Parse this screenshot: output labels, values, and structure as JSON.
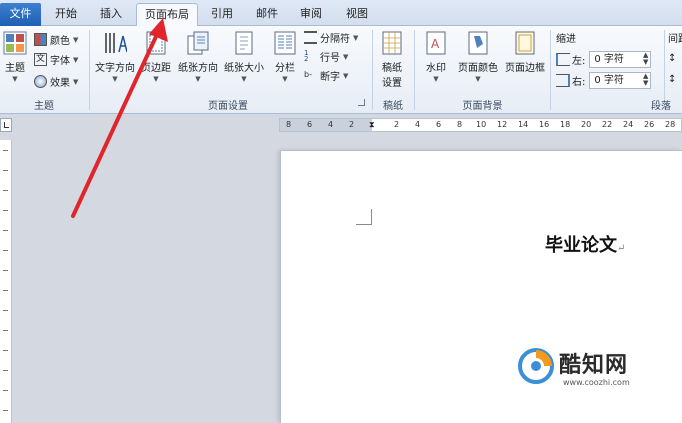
{
  "tabs": [
    {
      "label": "文件"
    },
    {
      "label": "开始"
    },
    {
      "label": "插入"
    },
    {
      "label": "页面布局"
    },
    {
      "label": "引用"
    },
    {
      "label": "邮件"
    },
    {
      "label": "审阅"
    },
    {
      "label": "视图"
    }
  ],
  "active_tab": "页面布局",
  "ribbon": {
    "theme_group": {
      "label": "主题",
      "theme_button": "主题",
      "colors": "颜色",
      "fonts": "字体",
      "effects": "效果"
    },
    "page_setup": {
      "label": "页面设置",
      "text_direction": "文字方向",
      "margins": "页边距",
      "orientation": "纸张方向",
      "size": "纸张大小",
      "columns": "分栏",
      "breaks": "分隔符",
      "line_numbers": "行号",
      "hyphenation": "断字"
    },
    "manuscript": {
      "label": "稿纸",
      "button_line1": "稿纸",
      "button_line2": "设置"
    },
    "page_background": {
      "label": "页面背景",
      "watermark": "水印",
      "page_color": "页面颜色",
      "page_borders": "页面边框"
    },
    "paragraph": {
      "label": "段落",
      "indent": "缩进",
      "spacing": "间距",
      "left_label": "左:",
      "left_value": "0 字符",
      "right_label": "右:",
      "right_value": "0 字符"
    }
  },
  "ruler": {
    "left_numbers": [
      "8",
      "6",
      "4",
      "2"
    ],
    "right_numbers": [
      "2",
      "4",
      "6",
      "8",
      "10",
      "12",
      "14",
      "16",
      "18",
      "20",
      "22",
      "24",
      "26",
      "28"
    ]
  },
  "document": {
    "title": "毕业论文",
    "paragraph_mark": "↵"
  },
  "watermark": {
    "name": "酷知网",
    "url": "www.coozhi.com"
  },
  "colors": {
    "accent": "#1d5fb3",
    "arrow": "#e0262c",
    "workspace": "#d4d9e1"
  }
}
